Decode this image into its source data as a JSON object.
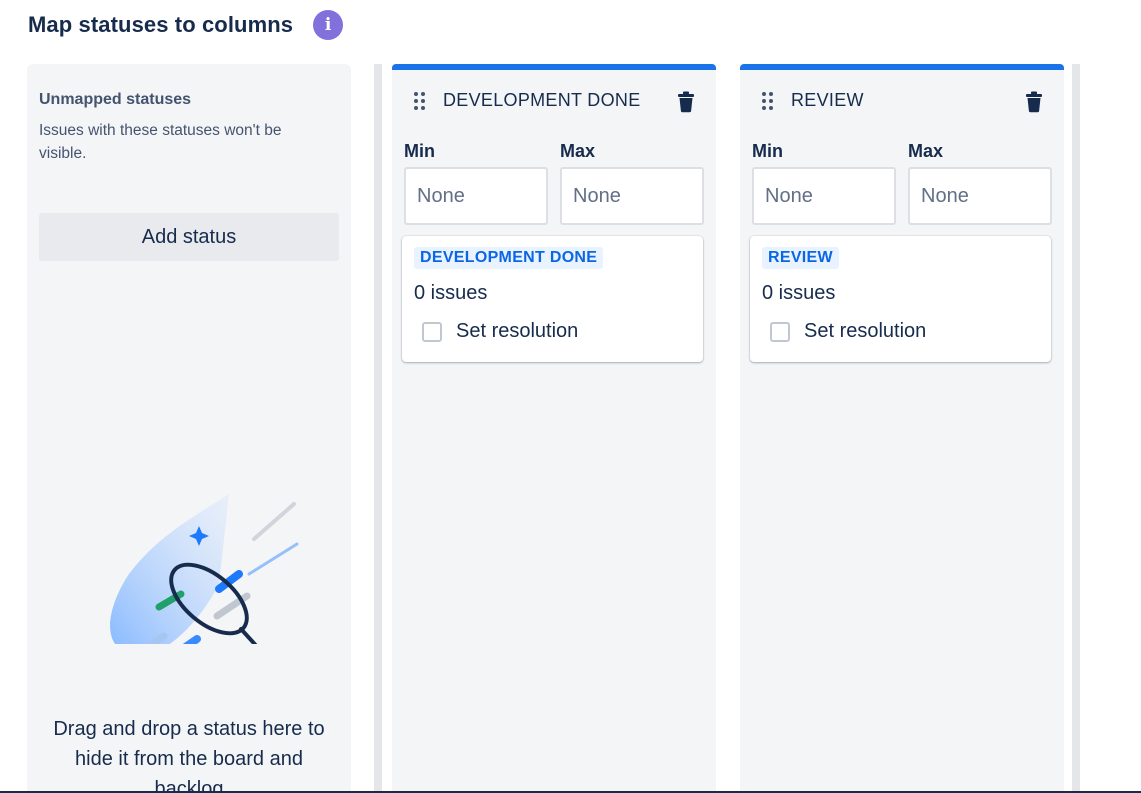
{
  "header": {
    "title": "Map statuses to columns",
    "info_icon": "info-icon"
  },
  "unmapped": {
    "title": "Unmapped statuses",
    "description": "Issues with these statuses won't be visible.",
    "add_status_label": "Add status",
    "drop_hint": "Drag and drop a status here to hide it from the board and backlog"
  },
  "columns": [
    {
      "name": "DEVELOPMENT DONE",
      "min_label": "Min",
      "max_label": "Max",
      "min_placeholder": "None",
      "max_placeholder": "None",
      "status": {
        "lozenge": "DEVELOPMENT DONE",
        "issues": "0 issues",
        "set_resolution": "Set resolution",
        "set_resolution_checked": false
      }
    },
    {
      "name": "REVIEW",
      "min_label": "Min",
      "max_label": "Max",
      "min_placeholder": "None",
      "max_placeholder": "None",
      "status": {
        "lozenge": "REVIEW",
        "issues": "0 issues",
        "set_resolution": "Set resolution",
        "set_resolution_checked": false
      }
    }
  ],
  "colors": {
    "accent": "#1a73e8",
    "info": "#8270db",
    "lozenge_bg": "#e9f2ff",
    "lozenge_text": "#0c66e4"
  }
}
